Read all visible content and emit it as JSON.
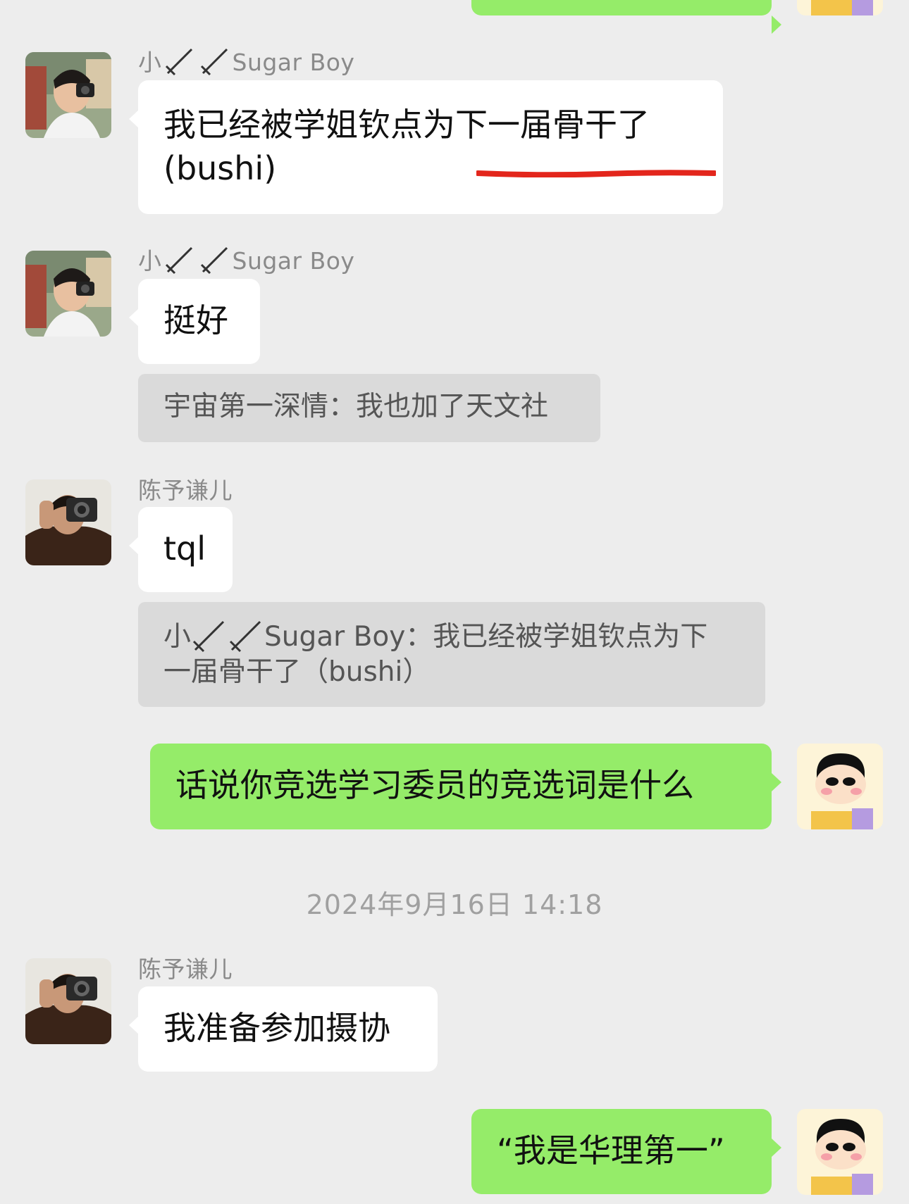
{
  "messages": {
    "m1": {
      "sender": "小🗡🗡Sugar Boy",
      "sender_prefix": "小",
      "sender_suffix": "Sugar Boy",
      "line1": "我已经被学姐钦点为下一届骨干了",
      "line2": "(bushi)"
    },
    "m2": {
      "sender": "小🗡🗡Sugar Boy",
      "sender_prefix": "小",
      "sender_suffix": "Sugar Boy",
      "text": "挺好"
    },
    "q1": {
      "text": "宇宙第一深情：我也加了天文社"
    },
    "m3": {
      "sender": "陈予谦儿",
      "text": "tql"
    },
    "q2": {
      "prefix": "小",
      "rest_line1": "Sugar Boy：我已经被学姐钦点为下",
      "line2": "一届骨干了（bushi）"
    },
    "m4": {
      "text": "话说你竞选学习委员的竞选词是什么"
    },
    "timestamp": "2024年9月16日 14:18",
    "m5": {
      "sender": "陈予谦儿",
      "text": "我准备参加摄协"
    },
    "m6": {
      "text": "“我是华理第一”"
    }
  },
  "colors": {
    "background": "#ededed",
    "bubble_in": "#ffffff",
    "bubble_out": "#95ec69",
    "quote_bg": "#dadada",
    "annotation": "#e3261c"
  },
  "icons": {
    "blade": "dagger-icon",
    "avatar_left_1": "photographer-avatar",
    "avatar_left_2": "camera-avatar",
    "avatar_self": "crayon-shinchan-avatar"
  }
}
